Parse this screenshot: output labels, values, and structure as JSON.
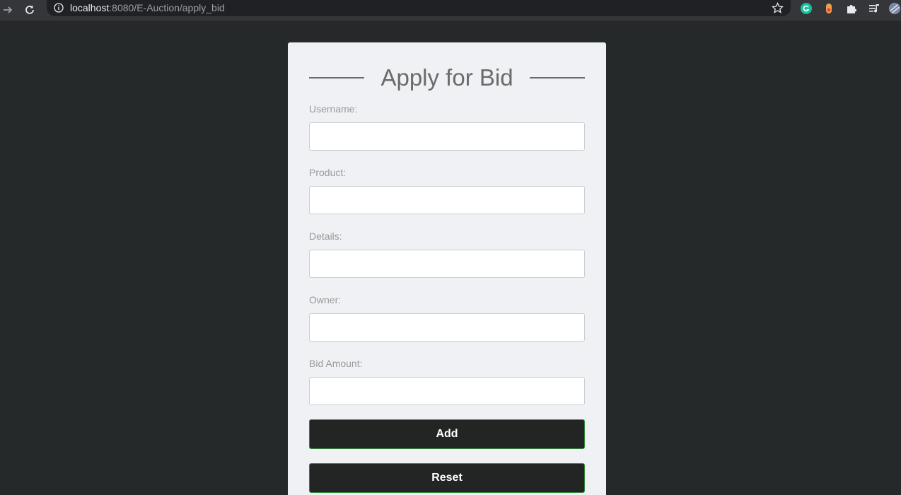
{
  "browser": {
    "url_host": "localhost",
    "url_rest": ":8080/E-Auction/apply_bid"
  },
  "form": {
    "title": "Apply for Bid",
    "fields": [
      {
        "label": "Username:",
        "value": "",
        "placeholder": ""
      },
      {
        "label": "Product:",
        "value": "",
        "placeholder": ""
      },
      {
        "label": "Details:",
        "value": "",
        "placeholder": ""
      },
      {
        "label": "Owner:",
        "value": "",
        "placeholder": ""
      },
      {
        "label": "Bid Amount:",
        "value": "",
        "placeholder": ""
      }
    ],
    "add_label": "Add",
    "reset_label": "Reset"
  },
  "colors": {
    "page_background": "#262929",
    "card_background": "#f0f1f4",
    "button_background": "#232424",
    "button_border": "#2f8a3a"
  },
  "icons": [
    "forward-icon",
    "reload-icon",
    "info-icon",
    "bookmark-star-icon",
    "grammarly-icon",
    "extension-icon",
    "puzzle-icon",
    "media-icon",
    "profile-avatar"
  ]
}
